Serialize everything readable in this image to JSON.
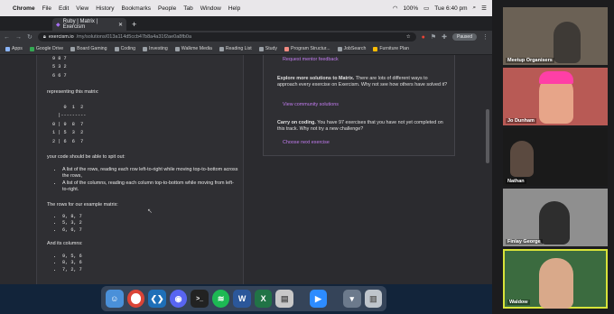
{
  "menubar": {
    "app": "Chrome",
    "items": [
      "File",
      "Edit",
      "View",
      "History",
      "Bookmarks",
      "People",
      "Tab",
      "Window",
      "Help"
    ],
    "battery": "100%",
    "clock": "Tue 6:40 pm"
  },
  "tab": {
    "title": "Ruby | Matrix | Exercism"
  },
  "address": {
    "host": "exercism.io",
    "path": "/my/solutions/013a114d5ccb47b8a4a31f2ae0a8fb0a",
    "profile": "Paused"
  },
  "bookmarks": [
    "Apps",
    "Google Drive",
    "Board Gaming",
    "Coding",
    "Investing",
    "Walkme Media",
    "Reading List",
    "Study",
    "Program Structur...",
    "JobSearch",
    "Furniture Plan"
  ],
  "exercise": {
    "matrix_lines": [
      "9 8 7",
      "5 3 2",
      "6 6 7"
    ],
    "representing": "representing this matrix:",
    "table_header": "    0  1  2",
    "table_rule": "  |---------",
    "table_rows": [
      "0 | 9  8  7",
      "1 | 5  3  2",
      "2 | 6  6  7"
    ],
    "spit_out": "your code should be able to spit out:",
    "bullets": [
      "A list of the rows, reading each row left-to-right while moving top-to-bottom across the rows,",
      "A list of the columns, reading each column top-to-bottom while moving from left-to-right."
    ],
    "rows_intro": "The rows for our example matrix:",
    "rows": [
      "9, 8, 7",
      "5, 3, 2",
      "6, 6, 7"
    ],
    "cols_intro": "And its columns:",
    "cols": [
      "9, 5, 6",
      "8, 3, 6",
      "7, 2, 7"
    ]
  },
  "sidebar": {
    "mentor_link": "Request mentor feedback",
    "explore_title": "Explore more solutions to Matrix.",
    "explore_text": "There are lots of different ways to approach every exercise on Exercism. Why not see how others have solved it?",
    "community_link": "View community solutions",
    "carry_title": "Carry on coding.",
    "carry_text": "You have 97 exercises that you have not yet completed on this track. Why not try a new challenge?",
    "next_link": "Choose next exercise"
  },
  "participants": [
    "Meetup Organisers",
    "Jo Dunham",
    "Nathan",
    "Finlay George",
    "Waldow"
  ],
  "colors": {
    "accent_link": "#c27cf0",
    "active_speaker": "#d8e33a"
  }
}
